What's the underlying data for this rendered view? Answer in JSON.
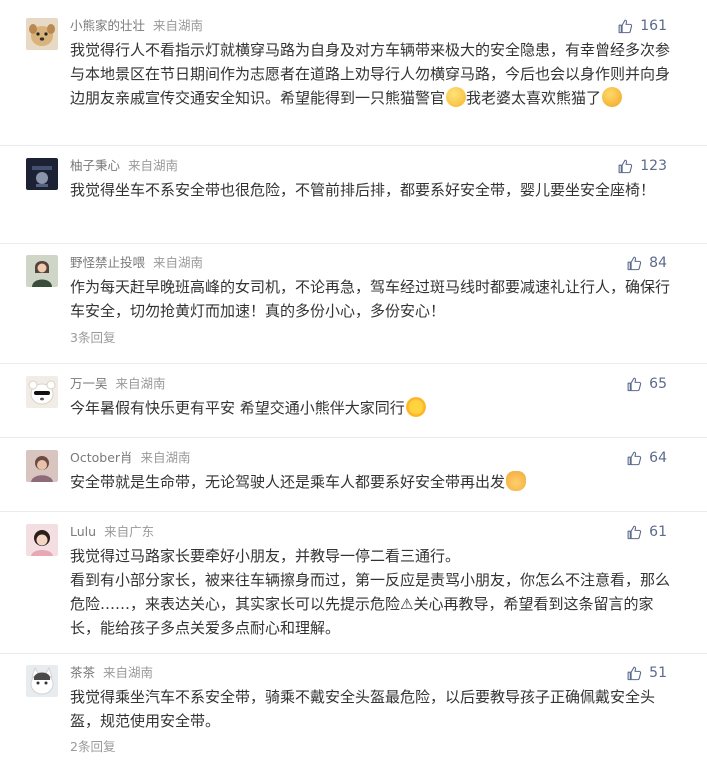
{
  "comments": [
    {
      "user": "小熊家的壮壮",
      "location": "来自湖南",
      "likes": "161",
      "text": "我觉得行人不看指示灯就横穿马路为自身及对方车辆带来极大的安全隐患，有幸曾经多次参与本地景区在节日期间作为志愿者在道路上劝导行人勿横穿马路，今后也会以身作则并向身边朋友亲戚宣传交通安全知识。希望能得到一只熊猫警官",
      "text_tail": "我老婆太喜欢熊猫了",
      "emojis": [
        "thinking-emoji",
        "surprised-emoji"
      ]
    },
    {
      "user": "柚子秉心",
      "location": "来自湖南",
      "likes": "123",
      "text": "我觉得坐车不系安全带也很危险，不管前排后排，都要系好安全带，婴儿要坐安全座椅！"
    },
    {
      "user": "野怪禁止投喂",
      "location": "来自湖南",
      "likes": "84",
      "text": "作为每天赶早晚班高峰的女司机，不论再急，驾车经过斑马线时都要减速礼让行人，确保行车安全，切勿抢黄灯而加速！真的多份小心，多份安心！",
      "replies": "3条回复"
    },
    {
      "user": "万一吴",
      "location": "来自湖南",
      "likes": "65",
      "text": "今年暑假有快乐更有平安 希望交通小熊伴大家同行",
      "emojis": [
        "sun-emoji"
      ]
    },
    {
      "user": "October肖",
      "location": "来自湖南",
      "likes": "64",
      "text": "安全带就是生命带，无论驾驶人还是乘车人都要系好安全带再出发",
      "emojis": [
        "victory-hand-emoji"
      ]
    },
    {
      "user": "Lulu",
      "location": "来自广东",
      "likes": "61",
      "text": "我觉得过马路家长要牵好小朋友，并教导一停二看三通行。",
      "text_2": "看到有小部分家长，被来往车辆擦身而过，第一反应是责骂小朋友，你怎么不注意看，那么危险……，来表达关心，其实家长可以先提示危险⚠关心再教导，希望看到这条留言的家长，能给孩子多点关爱多点耐心和理解。"
    },
    {
      "user": "茶茶",
      "location": "来自湖南",
      "likes": "51",
      "text": "我觉得乘坐汽车不系安全带，骑乘不戴安全头盔最危险，以后要教导孩子正确佩戴安全头盔，规范使用安全带。",
      "replies": "2条回复"
    }
  ],
  "colors": {
    "text": "#333333",
    "meta": "#9a9a9a",
    "like": "#5b6b8c",
    "divider": "#ececec"
  }
}
